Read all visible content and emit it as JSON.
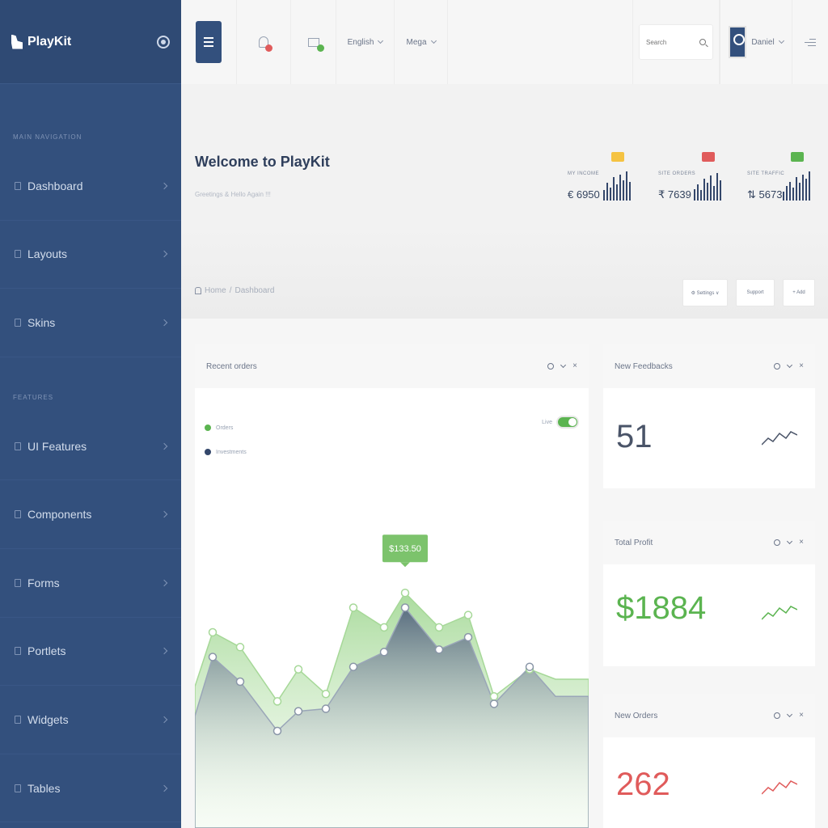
{
  "brand": {
    "name": "PlayKit"
  },
  "sidebar": {
    "section_main": "MAIN NAVIGATION",
    "section_features": "FEATURES",
    "items": [
      {
        "label": "Dashboard"
      },
      {
        "label": "Layouts"
      },
      {
        "label": "Skins"
      },
      {
        "label": "UI Features"
      },
      {
        "label": "Components"
      },
      {
        "label": "Forms"
      },
      {
        "label": "Portlets"
      },
      {
        "label": "Widgets"
      },
      {
        "label": "Tables"
      }
    ]
  },
  "header": {
    "language": "English",
    "mega": "Mega",
    "search_placeholder": "Search",
    "user": "Daniel"
  },
  "welcome": {
    "title": "Welcome to PlayKit",
    "subtitle": "Greetings & Hello Again !!!"
  },
  "stats": [
    {
      "label": "MY INCOME",
      "value": "€ 6950",
      "badge_color": "#f5c342",
      "bars": [
        0.35,
        0.6,
        0.45,
        0.8,
        0.55,
        0.9,
        0.7,
        1.0,
        0.65
      ]
    },
    {
      "label": "SITE ORDERS",
      "value": "₹ 7639",
      "badge_color": "#e05b5b",
      "bars": [
        0.4,
        0.55,
        0.35,
        0.75,
        0.6,
        0.85,
        0.5,
        0.95,
        0.7
      ]
    },
    {
      "label": "SITE TRAFFIC",
      "value": "⇅ 5673",
      "badge_color": "#5bb450",
      "bars": [
        0.3,
        0.5,
        0.65,
        0.45,
        0.8,
        0.6,
        0.9,
        0.75,
        1.0
      ]
    }
  ],
  "breadcrumb": {
    "home": "Home",
    "sep": "/",
    "current": "Dashboard"
  },
  "actions": {
    "settings": "⚙ Settings ∨",
    "support": "Support",
    "add": "+ Add"
  },
  "orders_card": {
    "title": "Recent orders",
    "legend": [
      {
        "label": "Orders",
        "color": "#5bb450"
      },
      {
        "label": "Investments",
        "color": "#34476b"
      }
    ],
    "toggle_label": "Live",
    "tooltip": "$133.50",
    "chart": {
      "orders": [
        48,
        70,
        64,
        42,
        55,
        45,
        80,
        72,
        86,
        72,
        77,
        44,
        55,
        51
      ],
      "investments": [
        36,
        60,
        50,
        30,
        38,
        39,
        56,
        62,
        80,
        63,
        68,
        41,
        56,
        44
      ]
    }
  },
  "feedback_card": {
    "title": "New Feedbacks",
    "value": "51",
    "color": "#4a5468"
  },
  "profit_card": {
    "title": "Total Profit",
    "value": "$1884",
    "color": "#5bb450"
  },
  "neworders_card": {
    "title": "New Orders",
    "value": "262",
    "color": "#e05b5b"
  }
}
